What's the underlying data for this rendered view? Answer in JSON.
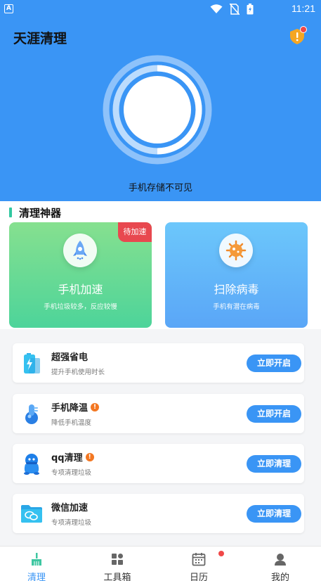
{
  "status_bar": {
    "time": "11:21",
    "a_label": "A"
  },
  "header": {
    "title": "天涯清理"
  },
  "gauge": {
    "status_text": "手机存储不可见"
  },
  "section": {
    "title": "清理神器"
  },
  "tools": [
    {
      "name": "手机加速",
      "desc": "手机垃圾较多，反应较慢",
      "badge": "待加速"
    },
    {
      "name": "扫除病毒",
      "desc": "手机有潜在病毒"
    }
  ],
  "features": [
    {
      "title": "超强省电",
      "desc": "提升手机使用时长",
      "button": "立即开启",
      "icon": "battery-icon"
    },
    {
      "title": "手机降温",
      "desc": "降低手机温度",
      "button": "立即开启",
      "icon": "thermometer-icon",
      "warn": "!"
    },
    {
      "title": "qq清理",
      "desc": "专项清理垃圾",
      "button": "立即清理",
      "icon": "qq-penguin-icon",
      "warn": "!"
    },
    {
      "title": "微信加速",
      "desc": "专项清理垃圾",
      "button": "立即清理",
      "icon": "wechat-folder-icon"
    }
  ],
  "tabs": [
    {
      "label": "清理",
      "icon": "broom-icon",
      "active": true
    },
    {
      "label": "工具箱",
      "icon": "toolbox-icon"
    },
    {
      "label": "日历",
      "icon": "calendar-icon"
    },
    {
      "label": "我的",
      "icon": "profile-icon"
    }
  ],
  "colors": {
    "primary": "#3a95f5",
    "accent_green": "#32c8a0",
    "alert_red": "#f04848",
    "warn_orange": "#f37722"
  }
}
